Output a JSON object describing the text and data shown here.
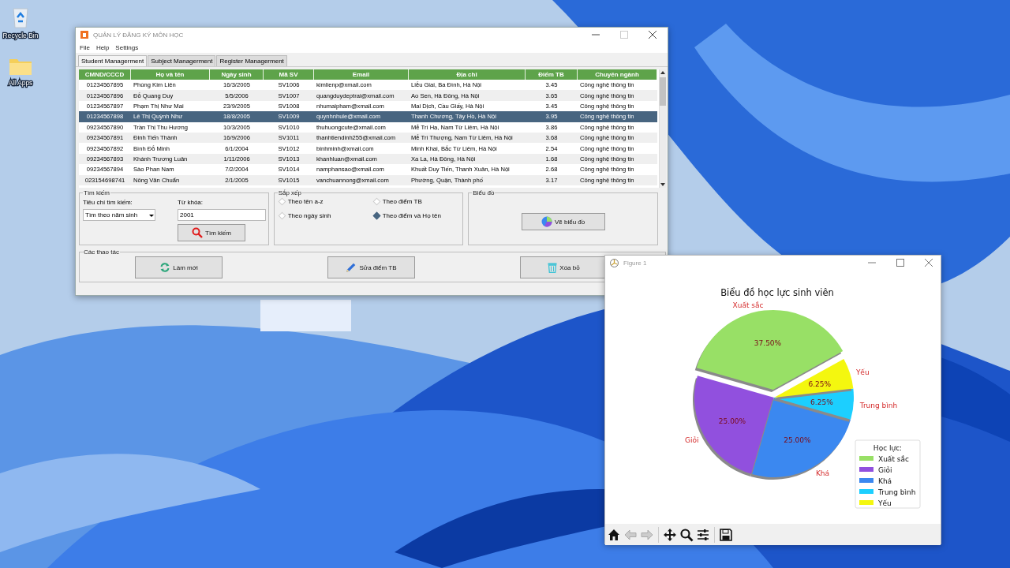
{
  "desktop": {
    "icons": [
      {
        "label": "Recycle Bin",
        "kind": "recycle"
      },
      {
        "label": "All Apps",
        "kind": "folder"
      }
    ]
  },
  "main_window": {
    "title": "QUẢN LÝ ĐĂNG KÝ MÔN HỌC",
    "menu": [
      "File",
      "Help",
      "Settings"
    ],
    "tabs": [
      {
        "label": "Student Managerment",
        "selected": true
      },
      {
        "label": "Subject Managerment",
        "selected": false
      },
      {
        "label": "Register Managerment",
        "selected": false
      }
    ],
    "table": {
      "columns": [
        "CMND/CCCD",
        "Họ và tên",
        "Ngày sinh",
        "Mã SV",
        "Email",
        "Địa chỉ",
        "Điểm TB",
        "Chuyên ngành"
      ],
      "rows": [
        {
          "selected": false,
          "cells": [
            "01234567895",
            "Phùng Kim Liên",
            "16/3/2005",
            "SV1006",
            "kimlienp@xmail.com",
            "Liễu Giai, Ba Đình, Hà Nội",
            "3.45",
            "Công nghệ thông tin"
          ]
        },
        {
          "selected": false,
          "cells": [
            "01234567896",
            "Đỗ Quang Duy",
            "5/5/2006",
            "SV1007",
            "quangduydeptrai@xmail.com",
            "Ao Sen, Hà Đông, Hà Nội",
            "3.65",
            "Công nghệ thông tin"
          ]
        },
        {
          "selected": false,
          "cells": [
            "01234567897",
            "Phạm Thị Như Mai",
            "23/9/2005",
            "SV1008",
            "nhumaipham@xmail.com",
            "Mai Dịch, Cầu Giấy, Hà Nội",
            "3.45",
            "Công nghệ thông tin"
          ]
        },
        {
          "selected": true,
          "cells": [
            "01234567898",
            "Lê Thị Quỳnh Như",
            "18/8/2005",
            "SV1009",
            "quynhnhule@xmail.com",
            "Thanh Chương, Tây Hồ, Hà Nội",
            "3.95",
            "Công nghệ thông tin"
          ]
        },
        {
          "selected": false,
          "cells": [
            "09234567890",
            "Trần Thị Thu Hương",
            "10/3/2005",
            "SV1010",
            "thuhuongcute@xmail.com",
            "Mễ Trì Hạ, Nam Từ Liêm, Hà Nội",
            "3.86",
            "Công nghệ thông tin"
          ]
        },
        {
          "selected": false,
          "cells": [
            "09234567891",
            "Đinh Tiến Thành",
            "16/9/2006",
            "SV1011",
            "thanhtiendinh255@xmail.com",
            "Mễ Trì Thượng, Nam Từ Liêm, Hà Nội",
            "3.68",
            "Công nghệ thông tin"
          ]
        },
        {
          "selected": false,
          "cells": [
            "09234567892",
            "Bình Đỗ Minh",
            "6/1/2004",
            "SV1012",
            "binhminh@xmail.com",
            "Minh Khai, Bắc Từ Liêm, Hà Nội",
            "2.54",
            "Công nghệ thông tin"
          ]
        },
        {
          "selected": false,
          "cells": [
            "09234567893",
            "Khánh Trương Luân",
            "1/11/2006",
            "SV1013",
            "khanhluan@xmail.com",
            "Xa La, Hà Đông, Hà Nội",
            "1.68",
            "Công nghệ thông tin"
          ]
        },
        {
          "selected": false,
          "cells": [
            "09234567894",
            "Sào Phan Nam",
            "7/2/2004",
            "SV1014",
            "namphansao@xmail.com",
            "Khuất Duy Tiến, Thanh Xuân, Hà Nội",
            "2.68",
            "Công nghệ thông tin"
          ]
        },
        {
          "selected": false,
          "cells": [
            "023154698741",
            "Nông Văn Chuẩn",
            "2/1/2005",
            "SV1015",
            "vanchuannong@xmail.com",
            "Phường, Quận, Thành phố",
            "3.17",
            "Công nghệ thông tin"
          ]
        }
      ]
    },
    "search": {
      "title": "Tìm kiếm",
      "criteria_label": "Tiêu chí tìm kiếm:",
      "criteria_value": "Tìm theo năm sinh",
      "keyword_label": "Từ khóa:",
      "keyword_value": "2001",
      "button": "Tìm kiếm"
    },
    "sort": {
      "title": "Sắp xếp",
      "options": [
        {
          "label": "Theo tên a-z",
          "selected": false
        },
        {
          "label": "Theo điểm TB",
          "selected": false
        },
        {
          "label": "Theo ngày sinh",
          "selected": false
        },
        {
          "label": "Theo điểm và Họ tên",
          "selected": true
        }
      ]
    },
    "chart_panel": {
      "title": "Biểu đồ",
      "button": "Vẽ biểu đồ"
    },
    "actions": {
      "title": "Các thao tác",
      "buttons": [
        {
          "label": "Làm mới",
          "kind": "refresh"
        },
        {
          "label": "Sửa điểm TB",
          "kind": "edit"
        },
        {
          "label": "Xóa bỏ",
          "kind": "delete"
        }
      ]
    }
  },
  "figure_window": {
    "title": "Figure 1",
    "chart_data": {
      "type": "pie",
      "title": "Biểu đồ học lực sinh viên",
      "categories": [
        "Xuất sắc",
        "Giỏi",
        "Khá",
        "Trung bình",
        "Yếu"
      ],
      "series": [
        {
          "values": [
            37.5,
            25,
            25,
            6.25,
            6.25
          ]
        }
      ],
      "legend": {
        "title": "Học lực:"
      },
      "colors": [
        "#98e066",
        "#9150de",
        "#3b88f0",
        "#1ccfff",
        "#f4f70f"
      ],
      "value_labels": [
        "37.50%",
        "25.00%",
        "25.00%",
        "6.25%",
        "6.25%"
      ]
    }
  }
}
